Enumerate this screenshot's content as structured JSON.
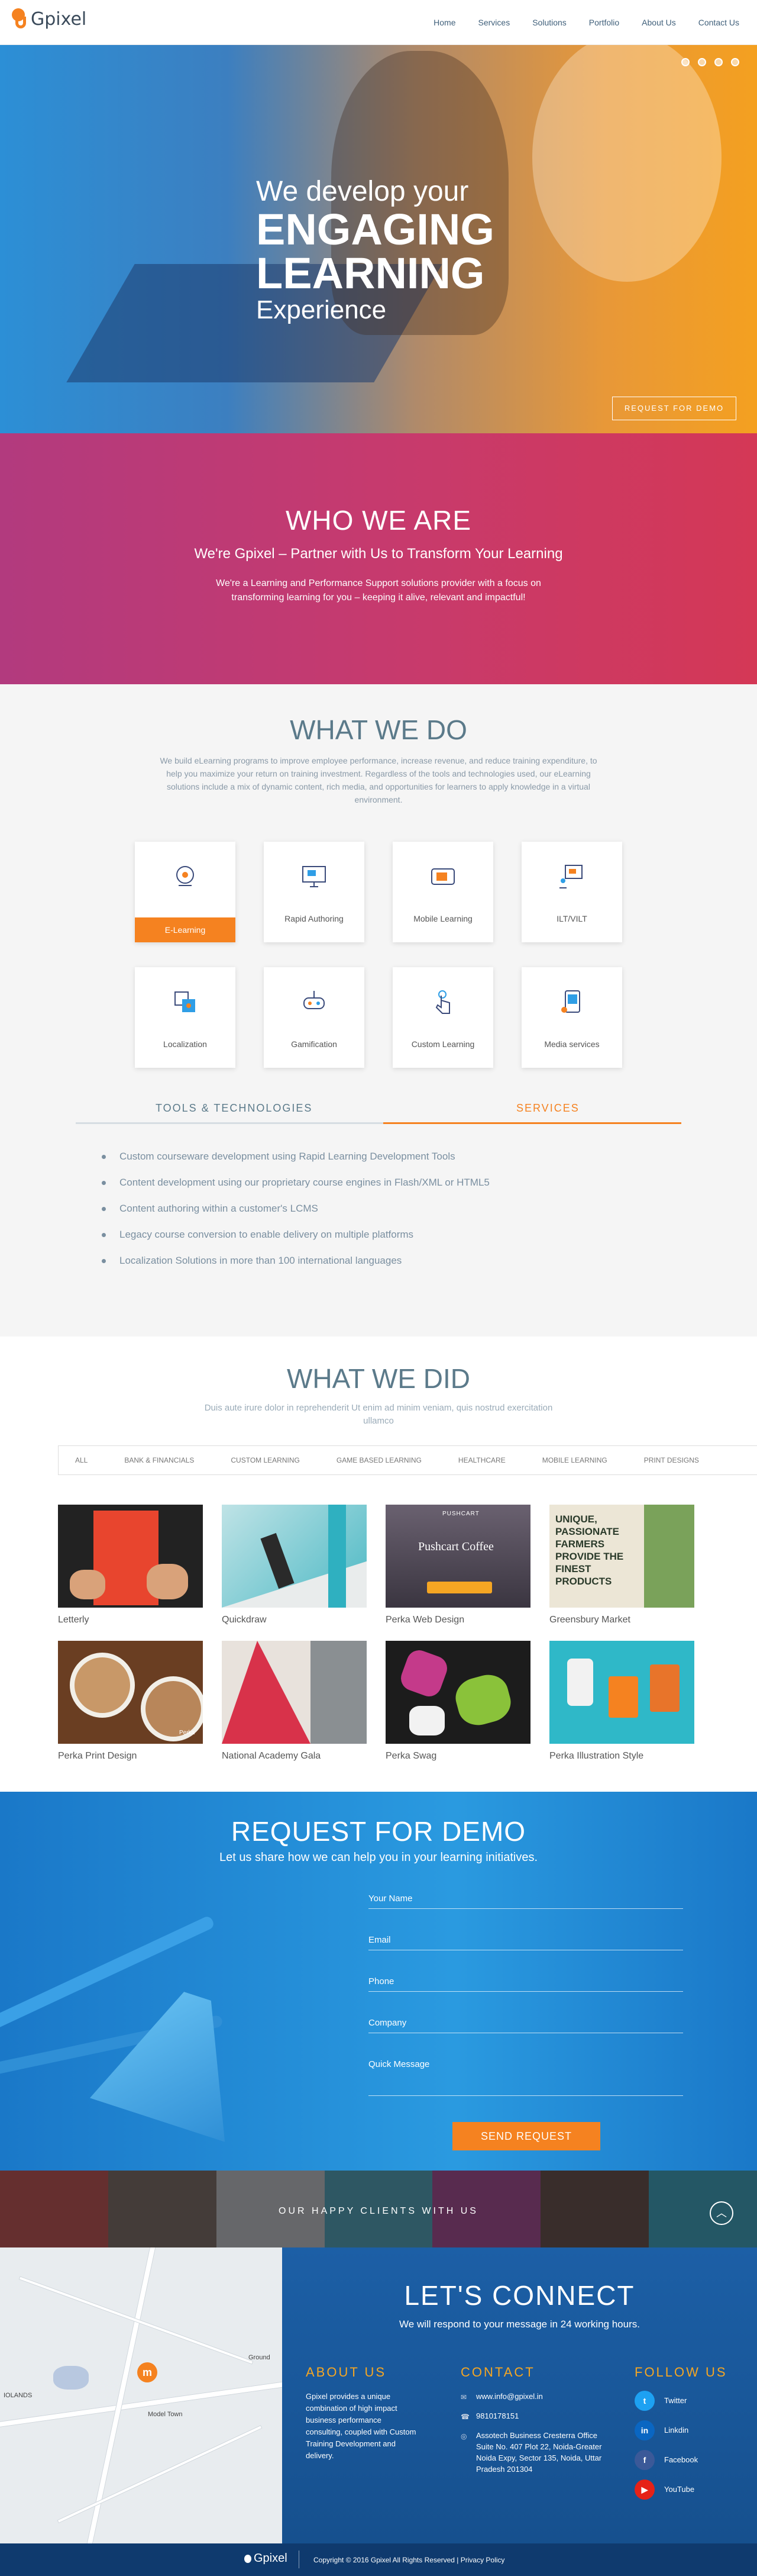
{
  "brand": {
    "name": "Gpixel",
    "accent": "#f58220"
  },
  "nav": {
    "items": [
      "Home",
      "Services",
      "Solutions",
      "Portfolio",
      "About Us",
      "Contact Us"
    ]
  },
  "hero": {
    "line1": "We develop your",
    "line2": "ENGAGING",
    "line3": "LEARNING",
    "line4": "Experience",
    "cta": "REQUEST FOR DEMO"
  },
  "who": {
    "title": "WHO WE ARE",
    "subtitle": "We're Gpixel – Partner with Us to Transform Your Learning",
    "body": "We're a Learning and Performance Support solutions provider with a focus on transforming learning for you – keeping it alive, relevant and impactful!"
  },
  "what_we_do": {
    "title": "WHAT WE DO",
    "desc": "We build eLearning programs to improve employee performance, increase revenue, and reduce training expenditure, to help you maximize your return on training investment. Regardless of the tools and technologies used, our eLearning solutions include a mix of dynamic content, rich media, and opportunities for learners to apply knowledge in a virtual environment.",
    "cards": [
      {
        "label": "E-Learning",
        "icon": "gear-head-icon"
      },
      {
        "label": "Rapid Authoring",
        "icon": "monitor-icon"
      },
      {
        "label": "Mobile Learning",
        "icon": "tablet-icon"
      },
      {
        "label": "ILT/VILT",
        "icon": "presentation-icon"
      },
      {
        "label": "Localization",
        "icon": "translate-icon"
      },
      {
        "label": "Gamification",
        "icon": "game-icon"
      },
      {
        "label": "Custom Learning",
        "icon": "hand-pointer-icon"
      },
      {
        "label": "Media services",
        "icon": "media-icon"
      }
    ],
    "tabs": [
      "TOOLS & TECHNOLOGIES",
      "SERVICES"
    ],
    "services": [
      "Custom courseware development using Rapid Learning Development Tools",
      "Content development using our proprietary course engines in Flash/XML or HTML5",
      "Content authoring within a customer's LCMS",
      "Legacy course conversion to enable delivery on multiple platforms",
      "Localization Solutions in more than 100 international languages"
    ]
  },
  "what_we_did": {
    "title": "WHAT WE DID",
    "desc": "Duis aute irure dolor in reprehenderit Ut enim ad minim veniam, quis nostrud exercitation ullamco",
    "filters": [
      "ALL",
      "BANK & FINANCIALS",
      "CUSTOM LEARNING",
      "GAME BASED LEARNING",
      "HEALTHCARE",
      "MOBILE LEARNING",
      "PRINT DESIGNS"
    ],
    "items": [
      "Letterly",
      "Quickdraw",
      "Perka Web Design",
      "Greensbury Market",
      "Perka Print Design",
      "National Academy Gala",
      "Perka Swag",
      "Perka Illustration Style"
    ],
    "thumb_texts": {
      "pushcart": "PUSHCART",
      "pushcart_coffee": "Pushcart Coffee",
      "greensbury": "UNIQUE, PASSIONATE FARMERS PROVIDE THE FINEST PRODUCTS",
      "perka": "Perka"
    }
  },
  "demo": {
    "title": "REQUEST FOR DEMO",
    "subtitle": "Let us share how we can help you in your learning initiatives.",
    "fields": [
      "Your Name",
      "Email",
      "Phone",
      "Company",
      "Quick Message"
    ],
    "submit": "SEND REQUEST"
  },
  "clients": {
    "title": "OUR HAPPY CLIENTS WITH US"
  },
  "connect": {
    "title": "LET'S CONNECT",
    "subtitle": "We will respond to your message in 24 working hours.",
    "about_title": "ABOUT US",
    "about_text": "Gpixel provides a unique combination of high impact business performance consulting, coupled with Custom Training Development and delivery.",
    "contact_title": "CONTACT",
    "email": "www.info@gpixel.in",
    "phone": "9810178151",
    "address": "Assotech Business Cresterra Office Suite No. 407 Plot 22, Noida-Greater Noida Expy, Sector 135, Noida, Uttar Pradesh 201304",
    "follow_title": "FOLLOW US",
    "social": [
      {
        "name": "Twitter",
        "color": "#1da1f2"
      },
      {
        "name": "Linkdin",
        "color": "#0a66c2"
      },
      {
        "name": "Facebook",
        "color": "#3b5998"
      },
      {
        "name": "YouTube",
        "color": "#e62117"
      }
    ],
    "map_labels": [
      "IOLANDS",
      "Model Town",
      "Ground"
    ]
  },
  "footer": {
    "copyright": "Copyright © 2016 Gpixel All Rights Reserved   |   Privacy Policy"
  }
}
